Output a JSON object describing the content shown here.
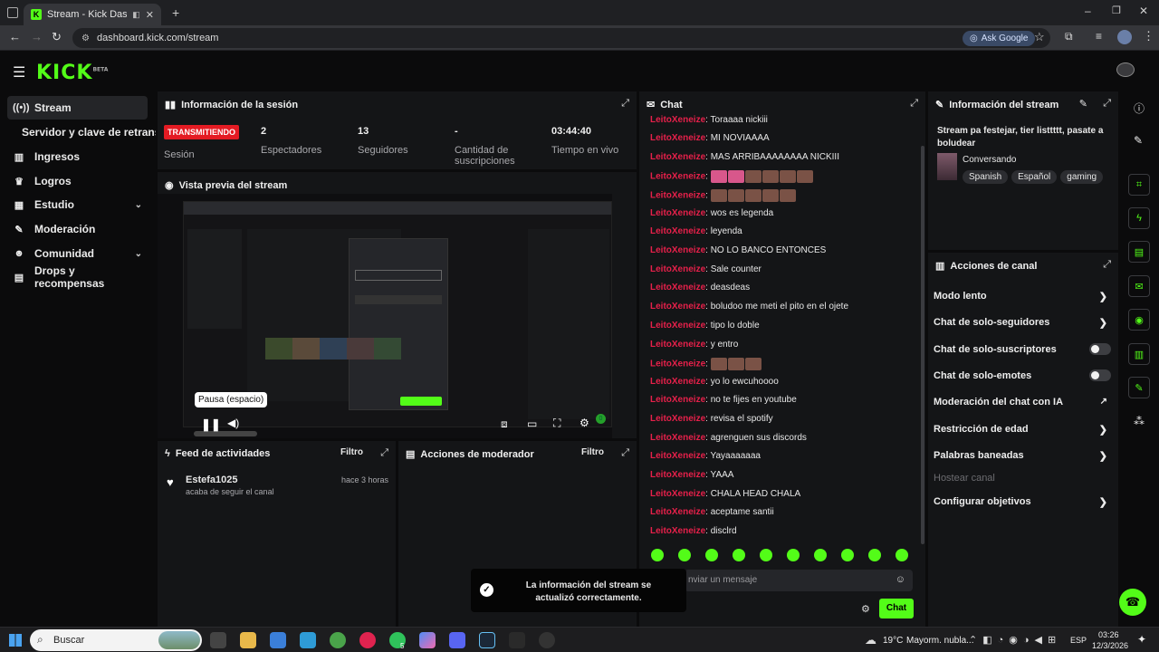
{
  "browser": {
    "tab_title": "Stream - Kick Dashboard",
    "url": "dashboard.kick.com/stream",
    "ask_google": "Ask Google"
  },
  "app": {
    "logo": "KICK",
    "logo_badge": "BETA"
  },
  "sidebar": {
    "items": [
      {
        "label": "Stream",
        "icon": "broadcast-icon"
      },
      {
        "label": "Servidor y clave de retransm"
      },
      {
        "label": "Ingresos",
        "icon": "chart-icon"
      },
      {
        "label": "Logros",
        "icon": "trophy-icon"
      },
      {
        "label": "Estudio",
        "icon": "grid-icon"
      },
      {
        "label": "Moderación",
        "icon": "wrench-icon"
      },
      {
        "label": "Comunidad",
        "icon": "people-icon"
      },
      {
        "label": "Drops y recompensas",
        "icon": "gift-icon"
      }
    ]
  },
  "session": {
    "title": "Información de la sesión",
    "live_badge": "TRANSMITIENDO",
    "live_label": "Sesión",
    "stats": [
      {
        "value": "2",
        "label": "Espectadores"
      },
      {
        "value": "13",
        "label": "Seguidores"
      },
      {
        "value": "-",
        "label": "Cantidad de suscripciones"
      },
      {
        "value": "03:44:40",
        "label": "Tiempo en vivo"
      }
    ]
  },
  "preview": {
    "title": "Vista previa del stream",
    "tooltip": "Pausa (espacio)",
    "live_dot": "0"
  },
  "feed": {
    "title": "Feed de actividades",
    "filter": "Filtro",
    "items": [
      {
        "user": "Estefa1025",
        "time": "hace 3 horas",
        "text": "acaba de seguir el canal"
      }
    ]
  },
  "mod_actions": {
    "title": "Acciones de moderador",
    "filter": "Filtro"
  },
  "chat": {
    "title": "Chat",
    "messages": [
      {
        "user": "LeitoXeneize",
        "text": ": Toraaaa nickiii"
      },
      {
        "user": "LeitoXeneize",
        "text": ": MI NOVIAAAA"
      },
      {
        "user": "LeitoXeneize",
        "text": ": MAS ARRIBAAAAAAAA NICKIII"
      },
      {
        "user": "LeitoXeneize",
        "text": ":"
      },
      {
        "user": "LeitoXeneize",
        "text": ":"
      },
      {
        "user": "LeitoXeneize",
        "text": ": wos es legenda"
      },
      {
        "user": "LeitoXeneize",
        "text": ": leyenda"
      },
      {
        "user": "LeitoXeneize",
        "text": ": NO LO BANCO ENTONCES"
      },
      {
        "user": "LeitoXeneize",
        "text": ": Sale counter"
      },
      {
        "user": "LeitoXeneize",
        "text": ": deasdeas"
      },
      {
        "user": "LeitoXeneize",
        "text": ": boludoo me meti el pito en el ojete"
      },
      {
        "user": "LeitoXeneize",
        "text": ": tipo lo doble"
      },
      {
        "user": "LeitoXeneize",
        "text": ": y entro"
      },
      {
        "user": "LeitoXeneize",
        "text": ":"
      },
      {
        "user": "LeitoXeneize",
        "text": ": yo lo ewcuhoooo"
      },
      {
        "user": "LeitoXeneize",
        "text": ": no te fijes en youtube"
      },
      {
        "user": "LeitoXeneize",
        "text": ": revisa el spotify"
      },
      {
        "user": "LeitoXeneize",
        "text": ": agrenguen sus discords"
      },
      {
        "user": "LeitoXeneize",
        "text": ": Yayaaaaaaa"
      },
      {
        "user": "LeitoXeneize",
        "text": ": YAAA"
      },
      {
        "user": "LeitoXeneize",
        "text": ": CHALA HEAD CHALA"
      },
      {
        "user": "LeitoXeneize",
        "text": ": aceptame santii"
      },
      {
        "user": "LeitoXeneize",
        "text": ": disclrd"
      }
    ],
    "input_placeholder": "nviar un mensaje",
    "send_label": "Chat",
    "toast": "La información del stream se actualizó correctamente."
  },
  "stream_info": {
    "title": "Información del stream",
    "stream_title": "Stream pa festejar, tier listtttt, pasate a boludear",
    "category": "Conversando",
    "tags": [
      "Spanish",
      "Español",
      "gaming"
    ]
  },
  "channel_actions": {
    "title": "Acciones de canal",
    "items": [
      {
        "label": "Modo lento",
        "control": "arrow"
      },
      {
        "label": "Chat de solo-seguidores",
        "control": "arrow"
      },
      {
        "label": "Chat de solo-suscriptores",
        "control": "toggle"
      },
      {
        "label": "Chat de solo-emotes",
        "control": "toggle"
      },
      {
        "label": "Moderación del chat con IA",
        "control": "external"
      },
      {
        "label": "Restricción de edad",
        "control": "arrow"
      },
      {
        "label": "Palabras baneadas",
        "control": "arrow"
      },
      {
        "label": "Hostear canal",
        "control": "disabled"
      },
      {
        "label": "Configurar objetivos",
        "control": "arrow"
      }
    ]
  },
  "taskbar": {
    "search": "Buscar",
    "weather": "19°C",
    "weather_desc": "Mayorm. nubla...",
    "lang": "ESP",
    "time": "03:26",
    "date": "12/3/2026",
    "whatsapp_badge": "5"
  },
  "colors": {
    "accent": "#53fc18",
    "username": "#e6204a",
    "live": "#e41b23"
  }
}
